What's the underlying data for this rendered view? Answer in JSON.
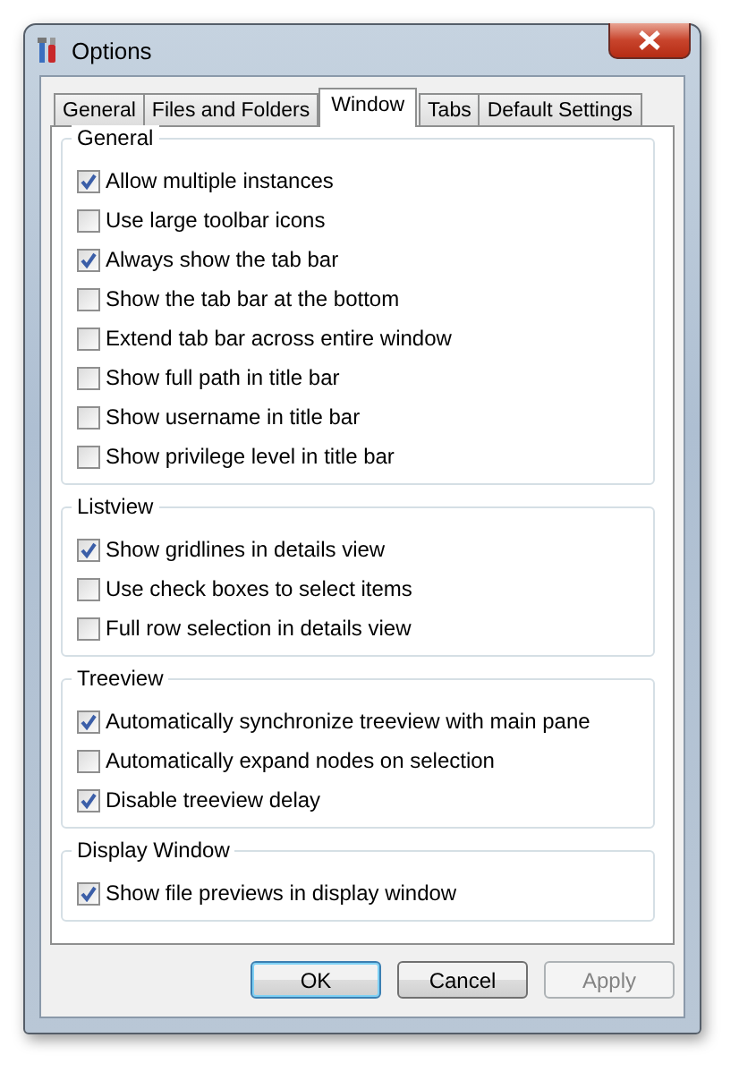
{
  "window": {
    "title": "Options"
  },
  "tabs": [
    {
      "label": "General",
      "selected": false
    },
    {
      "label": "Files and Folders",
      "selected": false
    },
    {
      "label": "Window",
      "selected": true
    },
    {
      "label": "Tabs",
      "selected": false
    },
    {
      "label": "Default Settings",
      "selected": false
    }
  ],
  "groups": [
    {
      "title": "General",
      "options": [
        {
          "label": "Allow multiple instances",
          "checked": true
        },
        {
          "label": "Use large toolbar icons",
          "checked": false
        },
        {
          "label": "Always show the tab bar",
          "checked": true
        },
        {
          "label": "Show the tab bar at the bottom",
          "checked": false
        },
        {
          "label": "Extend tab bar across entire window",
          "checked": false
        },
        {
          "label": "Show full path in title bar",
          "checked": false
        },
        {
          "label": "Show username in title bar",
          "checked": false
        },
        {
          "label": "Show privilege level in title bar",
          "checked": false
        }
      ]
    },
    {
      "title": "Listview",
      "options": [
        {
          "label": "Show gridlines in details view",
          "checked": true
        },
        {
          "label": "Use check boxes to select items",
          "checked": false
        },
        {
          "label": "Full row selection in details view",
          "checked": false
        }
      ]
    },
    {
      "title": "Treeview",
      "options": [
        {
          "label": "Automatically synchronize treeview with main pane",
          "checked": true
        },
        {
          "label": "Automatically expand nodes on selection",
          "checked": false
        },
        {
          "label": "Disable treeview delay",
          "checked": true
        }
      ]
    },
    {
      "title": "Display Window",
      "options": [
        {
          "label": "Show file previews in display window",
          "checked": true
        }
      ]
    }
  ],
  "buttons": [
    {
      "label": "OK",
      "default": true,
      "disabled": false
    },
    {
      "label": "Cancel",
      "default": false,
      "disabled": false
    },
    {
      "label": "Apply",
      "default": false,
      "disabled": true
    }
  ]
}
